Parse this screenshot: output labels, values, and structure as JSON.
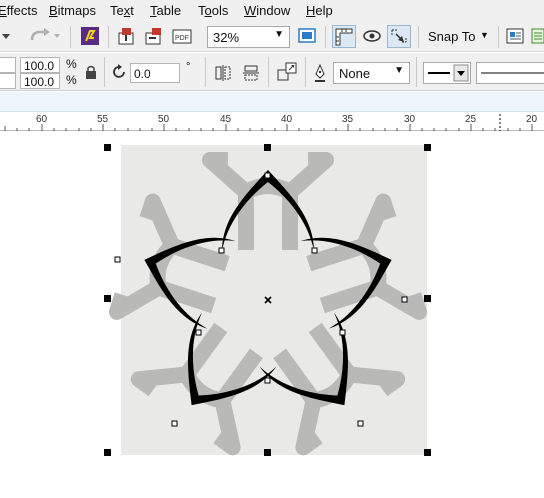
{
  "menubar": {
    "items": [
      {
        "label": "Effects",
        "mnemonic": "E"
      },
      {
        "label": "Bitmaps",
        "mnemonic": "B"
      },
      {
        "label": "Text",
        "mnemonic": "x"
      },
      {
        "label": "Table",
        "mnemonic": "T"
      },
      {
        "label": "Tools",
        "mnemonic": "o"
      },
      {
        "label": "Window",
        "mnemonic": "W"
      },
      {
        "label": "Help",
        "mnemonic": "H"
      }
    ]
  },
  "toolbar": {
    "zoom_level": "32%",
    "snap_to_label": "Snap To"
  },
  "property_bar": {
    "scale_width": "100.0",
    "scale_height": "100.0",
    "percent_top": "%",
    "percent_bottom": "%",
    "rotation_value": "0.0",
    "degree_symbol": "°",
    "outline_style": "None",
    "brand_color": "#5b2a86",
    "accent_color": "#2a7cc7"
  },
  "ruler": {
    "labels": [
      "60",
      "55",
      "50",
      "45",
      "40",
      "35",
      "30",
      "25",
      "20"
    ]
  }
}
